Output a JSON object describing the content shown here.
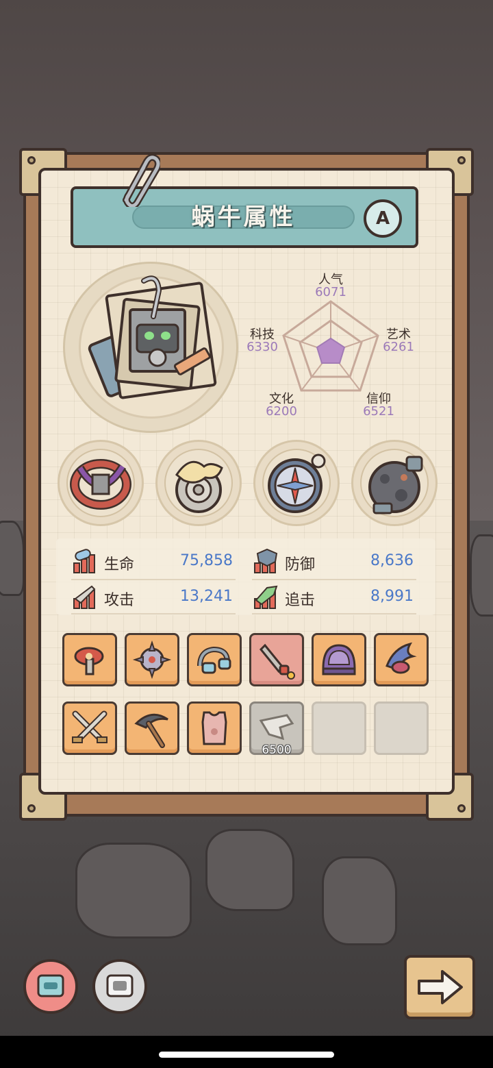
{
  "title": "蜗牛属性",
  "grade": "A",
  "radar": {
    "stats": [
      {
        "name": "人气",
        "value": "6071"
      },
      {
        "name": "艺术",
        "value": "6261"
      },
      {
        "name": "信仰",
        "value": "6521"
      },
      {
        "name": "文化",
        "value": "6200"
      },
      {
        "name": "科技",
        "value": "6330"
      }
    ]
  },
  "relics": [
    {
      "icon": "thorn-vine-icon"
    },
    {
      "icon": "snail-shell-icon"
    },
    {
      "icon": "compass-icon"
    },
    {
      "icon": "meteorite-icon"
    }
  ],
  "attributes": [
    {
      "name": "生命",
      "value": "75,858",
      "icon": "health-bar-icon"
    },
    {
      "name": "防御",
      "value": "8,636",
      "icon": "shield-bar-icon"
    },
    {
      "name": "攻击",
      "value": "13,241",
      "icon": "sword-bar-icon"
    },
    {
      "name": "追击",
      "value": "8,991",
      "icon": "pursuit-bar-icon"
    }
  ],
  "equipment": [
    {
      "icon": "raygun-icon",
      "style": "orange"
    },
    {
      "icon": "spiked-orb-icon",
      "style": "orange"
    },
    {
      "icon": "goggles-icon",
      "style": "orange"
    },
    {
      "icon": "rocket-blade-icon",
      "style": "red"
    },
    {
      "icon": "space-helmet-icon",
      "style": "orange"
    },
    {
      "icon": "winged-crest-icon",
      "style": "orange"
    },
    {
      "icon": "crossed-swords-icon",
      "style": "orange"
    },
    {
      "icon": "pickaxe-icon",
      "style": "orange"
    },
    {
      "icon": "armor-vest-icon",
      "style": "orange"
    },
    {
      "icon": "locked-gear-icon",
      "style": "gray",
      "cost": "6500"
    },
    {
      "icon": "",
      "style": "empty"
    },
    {
      "icon": "",
      "style": "empty"
    }
  ],
  "bottom": {
    "left_buttons": [
      "snail-card-icon",
      "robot-card-icon"
    ],
    "next_icon": "arrow-right-icon"
  },
  "colors": {
    "accent_banner": "#8fc0bf",
    "stat_value": "#4a78c8",
    "radar_value": "#9b79b8",
    "slot_orange": "#f3b574"
  }
}
